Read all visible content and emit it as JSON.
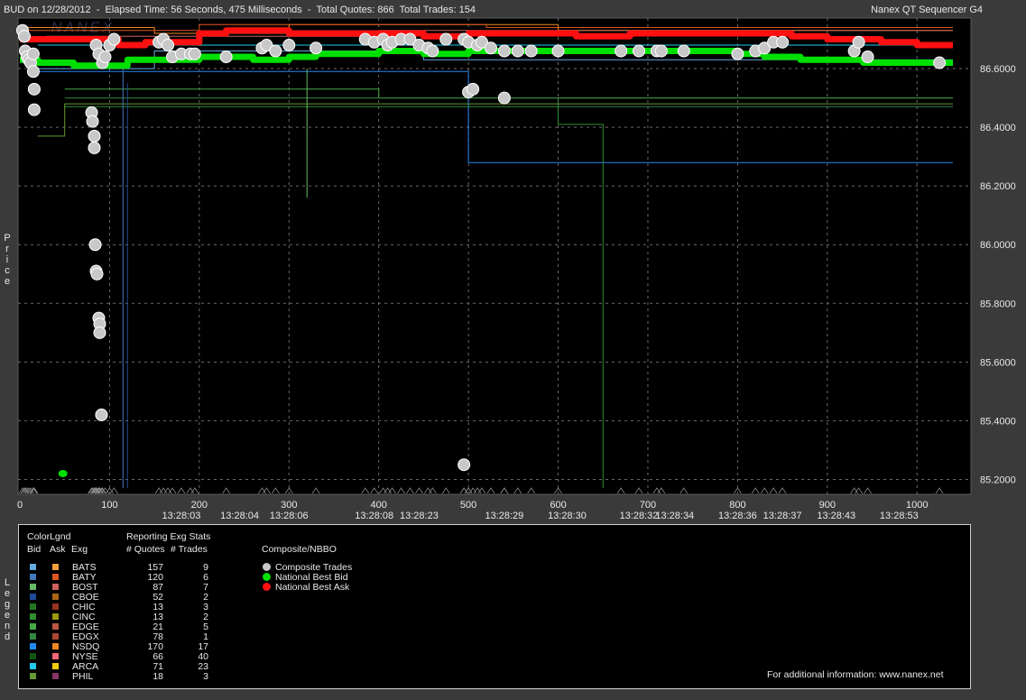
{
  "header": {
    "title_left": "BUD on 12/28/2012  -  Elapsed Time: 56 Seconds, 475 Milliseconds  -  Total Quotes: 866  Total Trades: 154",
    "title_right": "Nanex QT Sequencer G4",
    "watermark": "NANEX"
  },
  "side_labels": {
    "price": [
      "P",
      "r",
      "i",
      "c",
      "e"
    ],
    "legend": [
      "L",
      "e",
      "g",
      "e",
      "n",
      "d"
    ]
  },
  "colors": {
    "background": "#000000",
    "frame": "#3a3a3a",
    "grid": "#6a6a6a",
    "trade": "#c8c8c8",
    "nbb": "#00e000",
    "nba": "#ff1010"
  },
  "chart_data": {
    "type": "scatter",
    "title": "BUD on 12/28/2012",
    "ylabel": "Price",
    "ylim": [
      85.18,
      86.76
    ],
    "xlim": [
      0,
      1040
    ],
    "y_ticks": [
      "86.6000",
      "86.4000",
      "86.2000",
      "86.0000",
      "85.8000",
      "85.6000",
      "85.4000",
      "85.2000"
    ],
    "x_ticks": [
      "0",
      "100",
      "200",
      "300",
      "400",
      "500",
      "600",
      "700",
      "800",
      "900",
      "1000"
    ],
    "time_labels": [
      {
        "x": 180,
        "label": "13:28:03"
      },
      {
        "x": 245,
        "label": "13:28:04"
      },
      {
        "x": 300,
        "label": "13:28:06"
      },
      {
        "x": 395,
        "label": "13:28:08"
      },
      {
        "x": 445,
        "label": "13:28:23"
      },
      {
        "x": 540,
        "label": "13:28:29"
      },
      {
        "x": 610,
        "label": "13:28:30"
      },
      {
        "x": 690,
        "label": "13:28:32"
      },
      {
        "x": 730,
        "label": "13:28:34"
      },
      {
        "x": 800,
        "label": "13:28:36"
      },
      {
        "x": 850,
        "label": "13:28:37"
      },
      {
        "x": 910,
        "label": "13:28:43"
      },
      {
        "x": 980,
        "label": "13:28:53"
      }
    ],
    "composite_trades": [
      [
        3,
        86.73
      ],
      [
        5,
        86.71
      ],
      [
        6,
        86.66
      ],
      [
        8,
        86.64
      ],
      [
        10,
        86.63
      ],
      [
        12,
        86.62
      ],
      [
        15,
        86.59
      ],
      [
        16,
        86.53
      ],
      [
        16,
        86.46
      ],
      [
        15,
        86.65
      ],
      [
        80,
        86.45
      ],
      [
        81,
        86.42
      ],
      [
        83,
        86.37
      ],
      [
        83,
        86.33
      ],
      [
        84,
        86.0
      ],
      [
        85,
        85.91
      ],
      [
        86,
        85.9
      ],
      [
        88,
        85.75
      ],
      [
        89,
        85.73
      ],
      [
        89,
        85.7
      ],
      [
        91,
        85.42
      ],
      [
        85,
        86.68
      ],
      [
        88,
        86.65
      ],
      [
        92,
        86.62
      ],
      [
        95,
        86.64
      ],
      [
        100,
        86.68
      ],
      [
        105,
        86.7
      ],
      [
        155,
        86.69
      ],
      [
        160,
        86.7
      ],
      [
        165,
        86.68
      ],
      [
        170,
        86.64
      ],
      [
        180,
        86.65
      ],
      [
        190,
        86.65
      ],
      [
        195,
        86.65
      ],
      [
        230,
        86.64
      ],
      [
        270,
        86.67
      ],
      [
        275,
        86.68
      ],
      [
        285,
        86.66
      ],
      [
        300,
        86.68
      ],
      [
        330,
        86.67
      ],
      [
        385,
        86.7
      ],
      [
        395,
        86.69
      ],
      [
        405,
        86.7
      ],
      [
        410,
        86.68
      ],
      [
        415,
        86.69
      ],
      [
        425,
        86.7
      ],
      [
        435,
        86.7
      ],
      [
        445,
        86.68
      ],
      [
        455,
        86.67
      ],
      [
        460,
        86.66
      ],
      [
        475,
        86.7
      ],
      [
        495,
        86.7
      ],
      [
        500,
        86.69
      ],
      [
        510,
        86.68
      ],
      [
        515,
        86.69
      ],
      [
        525,
        86.67
      ],
      [
        540,
        86.66
      ],
      [
        500,
        86.52
      ],
      [
        505,
        86.53
      ],
      [
        540,
        86.5
      ],
      [
        495,
        85.25
      ],
      [
        555,
        86.66
      ],
      [
        570,
        86.66
      ],
      [
        600,
        86.66
      ],
      [
        670,
        86.66
      ],
      [
        690,
        86.66
      ],
      [
        710,
        86.66
      ],
      [
        715,
        86.66
      ],
      [
        740,
        86.66
      ],
      [
        800,
        86.65
      ],
      [
        820,
        86.66
      ],
      [
        830,
        86.67
      ],
      [
        840,
        86.69
      ],
      [
        850,
        86.69
      ],
      [
        930,
        86.66
      ],
      [
        935,
        86.69
      ],
      [
        945,
        86.64
      ],
      [
        1025,
        86.62
      ]
    ],
    "national_best_bid": {
      "x": [
        0,
        20,
        60,
        120,
        200,
        260,
        300,
        330,
        400,
        450,
        500,
        560,
        600,
        700,
        800,
        830,
        870,
        900,
        940,
        960,
        1000,
        1040
      ],
      "y": [
        86.63,
        86.62,
        86.61,
        86.63,
        86.64,
        86.63,
        86.64,
        86.65,
        86.66,
        86.65,
        86.66,
        86.66,
        86.66,
        86.66,
        86.65,
        86.64,
        86.63,
        86.63,
        86.62,
        86.62,
        86.62,
        86.62
      ]
    },
    "national_best_ask": {
      "x": [
        0,
        60,
        110,
        140,
        200,
        230,
        300,
        350,
        400,
        450,
        500,
        560,
        620,
        680,
        740,
        800,
        860,
        900,
        960,
        1000,
        1040
      ],
      "y": [
        86.7,
        86.7,
        86.68,
        86.69,
        86.72,
        86.73,
        86.72,
        86.72,
        86.72,
        86.71,
        86.72,
        86.72,
        86.71,
        86.72,
        86.72,
        86.72,
        86.71,
        86.7,
        86.69,
        86.68,
        86.68
      ]
    },
    "nbb_isolated_point": [
      48,
      85.22
    ],
    "legend": {
      "header_left": "ColorLgnd",
      "header_stats": "Reporting Exg Stats",
      "col_bid": "Bid",
      "col_ask": "Ask",
      "col_exg": "Exg",
      "col_quotes": "# Quotes",
      "col_trades": "# Trades",
      "composite_header": "Composite/NBBO",
      "composite_items": [
        {
          "label": "Composite Trades",
          "color": "#c8c8c8"
        },
        {
          "label": "National Best Bid",
          "color": "#00e000"
        },
        {
          "label": "National Best Ask",
          "color": "#ff1010"
        }
      ],
      "exchanges": [
        {
          "exg": "BATS",
          "quotes": "157",
          "trades": "9",
          "bid_color": "#66aadd",
          "ask_color": "#f0a040"
        },
        {
          "exg": "BATY",
          "quotes": "120",
          "trades": "6",
          "bid_color": "#4477bb",
          "ask_color": "#dd5520"
        },
        {
          "exg": "BOST",
          "quotes": "87",
          "trades": "7",
          "bid_color": "#66bb66",
          "ask_color": "#cc6060"
        },
        {
          "exg": "CBOE",
          "quotes": "52",
          "trades": "2",
          "bid_color": "#1f4a9a",
          "ask_color": "#aa6618"
        },
        {
          "exg": "CHIC",
          "quotes": "13",
          "trades": "3",
          "bid_color": "#227722",
          "ask_color": "#993322"
        },
        {
          "exg": "CINC",
          "quotes": "13",
          "trades": "2",
          "bid_color": "#2f8f2f",
          "ask_color": "#999911"
        },
        {
          "exg": "EDGE",
          "quotes": "21",
          "trades": "5",
          "bid_color": "#44aa44",
          "ask_color": "#bb5544"
        },
        {
          "exg": "EDGX",
          "quotes": "78",
          "trades": "1",
          "bid_color": "#338844",
          "ask_color": "#aa4433"
        },
        {
          "exg": "NSDQ",
          "quotes": "170",
          "trades": "17",
          "bid_color": "#2288ee",
          "ask_color": "#ee8822"
        },
        {
          "exg": "NYSE",
          "quotes": "66",
          "trades": "40",
          "bid_color": "#115511",
          "ask_color": "#ee6677"
        },
        {
          "exg": "ARCA",
          "quotes": "71",
          "trades": "23",
          "bid_color": "#22ccee",
          "ask_color": "#eecc11"
        },
        {
          "exg": "PHIL",
          "quotes": "18",
          "trades": "3",
          "bid_color": "#669933",
          "ask_color": "#883366"
        }
      ],
      "footer": "For additional information: www.nanex.net"
    }
  }
}
